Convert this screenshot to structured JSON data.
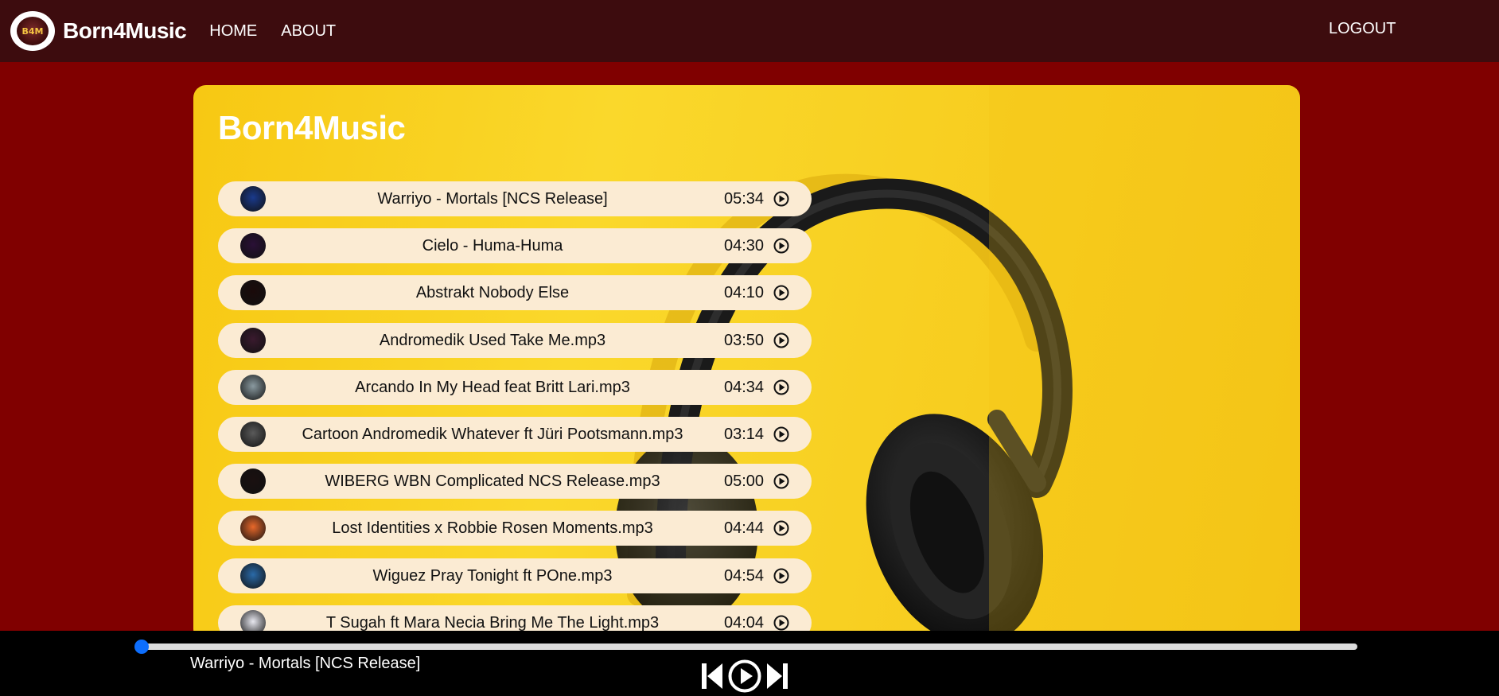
{
  "navbar": {
    "logo_text": "B4M",
    "brand": "Born4Music",
    "links": [
      "HOME",
      "ABOUT"
    ],
    "logout": "LOGOUT"
  },
  "main": {
    "title": "Born4Music",
    "songs": [
      {
        "name": "Warriyo - Mortals [NCS Release]",
        "duration": "05:34",
        "thumb_color": "#1a3a8c"
      },
      {
        "name": "Cielo - Huma-Huma",
        "duration": "04:30",
        "thumb_color": "#2a1036"
      },
      {
        "name": "Abstrakt Nobody Else",
        "duration": "04:10",
        "thumb_color": "#1a0a0a"
      },
      {
        "name": "Andromedik Used Take Me.mp3",
        "duration": "03:50",
        "thumb_color": "#3a1a2e"
      },
      {
        "name": "Arcando In My Head feat Britt Lari.mp3",
        "duration": "04:34",
        "thumb_color": "#8a9aa0"
      },
      {
        "name": "Cartoon Andromedik Whatever ft Jüri Pootsmann.mp3",
        "duration": "03:14",
        "thumb_color": "#5a5a5a"
      },
      {
        "name": "WIBERG WBN Complicated NCS Release.mp3",
        "duration": "05:00",
        "thumb_color": "#1a1010"
      },
      {
        "name": "Lost Identities x Robbie Rosen Moments.mp3",
        "duration": "04:44",
        "thumb_color": "#e8682a"
      },
      {
        "name": "Wiguez Pray Tonight ft POne.mp3",
        "duration": "04:54",
        "thumb_color": "#2a6aa8"
      },
      {
        "name": "T Sugah ft Mara Necia Bring Me The Light.mp3",
        "duration": "04:04",
        "thumb_color": "#e8e8f0"
      }
    ]
  },
  "player": {
    "now_playing": "Warriyo - Mortals [NCS Release]",
    "progress": 0,
    "accent": "#0d6efd"
  },
  "colors": {
    "page_bg": "#800000",
    "navbar_bg": "#3d0c0e",
    "row_bg": "#fbebd3",
    "card_bg": "#f7c813"
  }
}
